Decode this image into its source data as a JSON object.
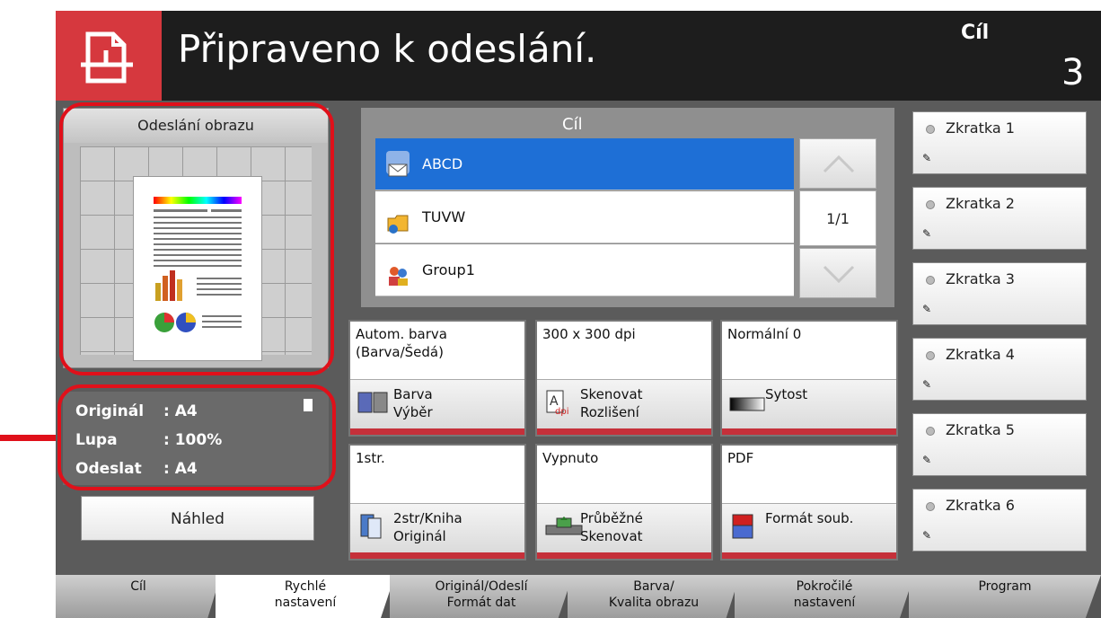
{
  "header": {
    "title": "Připraveno k odeslání.",
    "dest_label": "Cíl",
    "dest_count": "3"
  },
  "preview": {
    "title": "Odeslání obrazu",
    "original_key": "Originál",
    "original_val": ": A4",
    "zoom_key": "Lupa",
    "zoom_val": ": 100%",
    "send_key": "Odeslat",
    "send_val": ": A4",
    "preview_button": "Náhled"
  },
  "destinations": {
    "title": "Cíl",
    "items": [
      {
        "label": "ABCD",
        "selected": true,
        "icon": "email-icon"
      },
      {
        "label": "TUVW",
        "selected": false,
        "icon": "folder-icon"
      },
      {
        "label": "Group1",
        "selected": false,
        "icon": "group-icon"
      }
    ],
    "page_indicator": "1/1"
  },
  "quick_settings": [
    {
      "value": "Autom. barva\n(Barva/Šedá)",
      "label": "Barva\nVýběr",
      "icon": "color-select-icon"
    },
    {
      "value": "300 x 300 dpi",
      "label": "Skenovat\nRozlišení",
      "icon": "resolution-icon"
    },
    {
      "value": "Normální 0",
      "label": "Sytost",
      "icon": "density-icon"
    },
    {
      "value": "1str.",
      "label": "2str/Kniha\nOriginál",
      "icon": "duplex-icon"
    },
    {
      "value": "Vypnuto",
      "label": "Průběžné\nSkenovat",
      "icon": "continuous-scan-icon"
    },
    {
      "value": "PDF",
      "label": "Formát soub.",
      "icon": "file-format-icon"
    }
  ],
  "shortcuts": [
    {
      "label": "Zkratka 1"
    },
    {
      "label": "Zkratka 2"
    },
    {
      "label": "Zkratka 3"
    },
    {
      "label": "Zkratka 4"
    },
    {
      "label": "Zkratka 5"
    },
    {
      "label": "Zkratka 6"
    }
  ],
  "tabs": [
    {
      "label": "Cíl",
      "active": false
    },
    {
      "label": "Rychlé\nnastavení",
      "active": true
    },
    {
      "label": "Originál/Odeslí\nFormát dat",
      "active": false
    },
    {
      "label": "Barva/\nKvalita obrazu",
      "active": false
    },
    {
      "label": "Pokročilé\nnastavení",
      "active": false
    },
    {
      "label": "Program",
      "active": false
    }
  ],
  "colors": {
    "title_bar": "#1d1d1d",
    "icon_red": "#d6383e",
    "selected_row": "#1e6fd6",
    "highlight_outline": "#e0101a"
  }
}
